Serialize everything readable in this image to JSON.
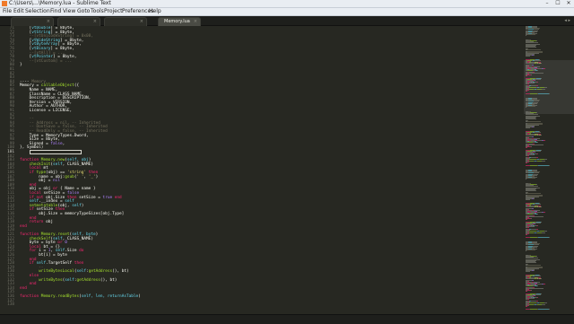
{
  "window": {
    "title": "C:\\Users\\...\\Memory.lua - Sublime Text",
    "controls": [
      "–",
      "☐",
      "✕"
    ]
  },
  "menubar": [
    "File",
    "Edit",
    "Selection",
    "Find",
    "View",
    "Goto",
    "Tools",
    "Project",
    "Preferences",
    "Help"
  ],
  "tabs": [
    {
      "label": "",
      "active": false
    },
    {
      "label": "",
      "active": false
    },
    {
      "label": "",
      "active": false
    },
    {
      "label": "Memory.lua",
      "active": true
    }
  ],
  "editor": {
    "current_line": 101,
    "lines": [
      {
        "n": 71,
        "segs": [
          [
            "    [",
            ""
          ],
          [
            "vtDouble",
            "cn"
          ],
          [
            "] = ",
            ""
          ],
          [
            "8",
            ""
          ],
          [
            "byte",
            ""
          ],
          [
            ",",
            ""
          ]
        ]
      },
      {
        "n": 72,
        "segs": [
          [
            "    [",
            ""
          ],
          [
            "vtString",
            "cn"
          ],
          [
            "] = ",
            ""
          ],
          [
            "8",
            ""
          ],
          [
            "byte",
            ""
          ],
          [
            ",",
            ""
          ]
        ]
      },
      {
        "n": 73,
        "segs": [
          [
            "    ",
            ""
          ],
          [
            "--[vtUnicodeString] = 0x08,",
            "cm"
          ]
        ]
      },
      {
        "n": 74,
        "segs": [
          [
            "    [",
            ""
          ],
          [
            "vtWideString",
            "cn"
          ],
          [
            "] = ",
            ""
          ],
          [
            "8",
            ""
          ],
          [
            "byte",
            ""
          ],
          [
            ",",
            ""
          ]
        ]
      },
      {
        "n": 75,
        "segs": [
          [
            "    [",
            ""
          ],
          [
            "vtByteArray",
            "cn"
          ],
          [
            "] = ",
            ""
          ],
          [
            "8",
            ""
          ],
          [
            "byte",
            ""
          ],
          [
            ",",
            ""
          ]
        ]
      },
      {
        "n": 76,
        "segs": [
          [
            "    [",
            ""
          ],
          [
            "vtBinary",
            "cn"
          ],
          [
            "] = ",
            ""
          ],
          [
            "8",
            ""
          ],
          [
            "byte",
            ""
          ],
          [
            ",",
            ""
          ]
        ]
      },
      {
        "n": 77,
        "segs": [
          [
            "    ",
            ""
          ],
          [
            "--[vtAll] = ...",
            "cm"
          ]
        ]
      },
      {
        "n": 78,
        "segs": [
          [
            "    [",
            ""
          ],
          [
            "vtPointer",
            "cn"
          ],
          [
            "] = ",
            ""
          ],
          [
            "8",
            ""
          ],
          [
            "byte",
            ""
          ],
          [
            ",",
            ""
          ]
        ]
      },
      {
        "n": 79,
        "segs": [
          [
            "    ",
            ""
          ],
          [
            "--[vtCustom] = ...",
            "cm"
          ]
        ]
      },
      {
        "n": 80,
        "segs": [
          [
            "}",
            ""
          ]
        ]
      },
      {
        "n": 81,
        "segs": []
      },
      {
        "n": 82,
        "segs": []
      },
      {
        "n": 83,
        "segs": []
      },
      {
        "n": 84,
        "segs": [
          [
            "---- ",
            ""
          ],
          [
            "Memory",
            "cm"
          ]
        ]
      },
      {
        "n": 85,
        "segs": [
          [
            "Memory = ",
            ""
          ],
          [
            "callableObject",
            "fn"
          ],
          [
            "({",
            ""
          ]
        ]
      },
      {
        "n": 86,
        "segs": [
          [
            "    Name = ",
            ""
          ],
          [
            "NAME",
            ""
          ],
          [
            ",",
            ""
          ]
        ]
      },
      {
        "n": 87,
        "segs": [
          [
            "    ClassName = ",
            ""
          ],
          [
            "CLASS_NAME",
            ""
          ],
          [
            ",",
            ""
          ]
        ]
      },
      {
        "n": 88,
        "segs": [
          [
            "    Description = ",
            ""
          ],
          [
            "DESCRIPTION",
            ""
          ],
          [
            ",",
            ""
          ]
        ]
      },
      {
        "n": 89,
        "segs": [
          [
            "    Version = ",
            ""
          ],
          [
            "VERSION",
            ""
          ],
          [
            ",",
            ""
          ]
        ]
      },
      {
        "n": 90,
        "segs": [
          [
            "    Author = ",
            ""
          ],
          [
            "AUTHOR",
            ""
          ],
          [
            ",",
            ""
          ]
        ]
      },
      {
        "n": 91,
        "segs": [
          [
            "    License = ",
            ""
          ],
          [
            "LICENSE",
            ""
          ],
          [
            ",",
            ""
          ]
        ]
      },
      {
        "n": 92,
        "segs": []
      },
      {
        "n": 93,
        "segs": [
          [
            "    ",
            ""
          ],
          [
            "--",
            "cm"
          ]
        ]
      },
      {
        "n": 94,
        "segs": [
          [
            "    ",
            ""
          ],
          [
            "-- Address = nil, -- Inherited",
            "cm"
          ]
        ]
      },
      {
        "n": 95,
        "segs": [
          [
            "    ",
            ""
          ],
          [
            "-- DontSave = false, -- Inherited",
            "cm"
          ]
        ]
      },
      {
        "n": 96,
        "segs": [
          [
            "    ",
            ""
          ],
          [
            "-- ReadOnly = false, -- Inherited",
            "cm"
          ]
        ]
      },
      {
        "n": 97,
        "segs": [
          [
            "    Type = ",
            ""
          ],
          [
            "MemoryTypes.Dword",
            ""
          ],
          [
            ",",
            ""
          ]
        ]
      },
      {
        "n": 98,
        "segs": [
          [
            "    Size = ",
            ""
          ],
          [
            "8",
            ""
          ],
          [
            "byte",
            ""
          ],
          [
            ",",
            ""
          ]
        ]
      },
      {
        "n": 99,
        "segs": [
          [
            "    Signed = ",
            ""
          ],
          [
            "false",
            "num"
          ],
          [
            ",",
            ""
          ]
        ]
      },
      {
        "n": 100,
        "segs": [
          [
            "}, Symbol)",
            ""
          ]
        ]
      },
      {
        "n": 101,
        "segs": []
      },
      {
        "n": 102,
        "segs": []
      },
      {
        "n": 103,
        "segs": [
          [
            "function ",
            "kw"
          ],
          [
            "Memory.new",
            "fn"
          ],
          [
            "(",
            ""
          ],
          [
            "self, obj",
            "cn"
          ],
          [
            ")",
            ""
          ]
        ]
      },
      {
        "n": 104,
        "segs": [
          [
            "    ",
            ""
          ],
          [
            "checkInit",
            "fn"
          ],
          [
            "(",
            ""
          ],
          [
            "self",
            "cn"
          ],
          [
            ", ",
            ""
          ],
          [
            "CLASS_NAME",
            ""
          ],
          [
            ")",
            ""
          ]
        ]
      },
      {
        "n": 105,
        "segs": [
          [
            "    ",
            ""
          ],
          [
            "local ",
            "kw"
          ],
          [
            "mt",
            ""
          ]
        ]
      },
      {
        "n": 106,
        "segs": [
          [
            "    ",
            ""
          ],
          [
            "if ",
            "kw"
          ],
          [
            "type",
            "fn"
          ],
          [
            "(obj) == ",
            ""
          ],
          [
            "'string'",
            "str"
          ],
          [
            " then",
            "kw"
          ]
        ]
      },
      {
        "n": 107,
        "segs": [
          [
            "        name = obj:",
            ""
          ],
          [
            "gsub",
            "fn"
          ],
          [
            "(",
            ""
          ],
          [
            "' '",
            "str"
          ],
          [
            ", ",
            ""
          ],
          [
            "'_'",
            "str"
          ],
          [
            ")",
            ""
          ]
        ]
      },
      {
        "n": 108,
        "segs": [
          [
            "        obj = ",
            ""
          ],
          [
            "nil",
            "num"
          ]
        ]
      },
      {
        "n": 109,
        "segs": [
          [
            "    ",
            ""
          ],
          [
            "end",
            "kw"
          ]
        ]
      },
      {
        "n": 110,
        "segs": [
          [
            "    obj = obj ",
            ""
          ],
          [
            "or ",
            "kw"
          ],
          [
            "{ Name = name }",
            ""
          ]
        ]
      },
      {
        "n": 111,
        "segs": [
          [
            "    ",
            ""
          ],
          [
            "local ",
            "kw"
          ],
          [
            "setSize = ",
            ""
          ],
          [
            "false",
            "num"
          ]
        ]
      },
      {
        "n": 112,
        "segs": [
          [
            "    ",
            ""
          ],
          [
            "if not ",
            "kw"
          ],
          [
            "obj.Size ",
            ""
          ],
          [
            "then ",
            "kw"
          ],
          [
            "setSize = ",
            ""
          ],
          [
            "true",
            "num"
          ],
          [
            " end",
            "kw"
          ]
        ]
      },
      {
        "n": 113,
        "segs": [
          [
            "    ",
            ""
          ],
          [
            "self",
            "cn"
          ],
          [
            "._",
            ""
          ],
          [
            "_index = ",
            ""
          ],
          [
            "self",
            "cn"
          ]
        ]
      },
      {
        "n": 114,
        "segs": [
          [
            "    ",
            ""
          ],
          [
            "setmetatable",
            "fn"
          ],
          [
            "(obj, ",
            ""
          ],
          [
            "self",
            "cn"
          ],
          [
            ")",
            ""
          ]
        ]
      },
      {
        "n": 115,
        "segs": [
          [
            "    ",
            ""
          ],
          [
            "if ",
            "kw"
          ],
          [
            "setSize ",
            ""
          ],
          [
            "then ",
            "kw"
          ]
        ]
      },
      {
        "n": 116,
        "segs": [
          [
            "        obj.Size = memoryTypeSizes[obj.Type] ",
            ""
          ]
        ]
      },
      {
        "n": 117,
        "segs": [
          [
            "    ",
            ""
          ],
          [
            "end",
            "kw"
          ]
        ]
      },
      {
        "n": 118,
        "segs": [
          [
            "    ",
            ""
          ],
          [
            "return ",
            "kw"
          ],
          [
            "obj",
            ""
          ]
        ]
      },
      {
        "n": 119,
        "segs": [
          [
            "end",
            "kw"
          ]
        ]
      },
      {
        "n": 120,
        "segs": []
      },
      {
        "n": 121,
        "segs": [
          [
            "function ",
            "kw"
          ],
          [
            "Memory.reset",
            "fn"
          ],
          [
            "(",
            ""
          ],
          [
            "self, byte",
            "cn"
          ],
          [
            ")",
            ""
          ]
        ]
      },
      {
        "n": 122,
        "segs": [
          [
            "    ",
            ""
          ],
          [
            "checkSelf",
            "fn"
          ],
          [
            "(",
            ""
          ],
          [
            "self",
            "cn"
          ],
          [
            ", ",
            ""
          ],
          [
            "CLASS_NAME",
            ""
          ],
          [
            ")",
            ""
          ]
        ]
      },
      {
        "n": 123,
        "segs": [
          [
            "    byte = byte ",
            ""
          ],
          [
            "or ",
            "kw"
          ],
          [
            "0",
            "num"
          ]
        ]
      },
      {
        "n": 124,
        "segs": [
          [
            "    ",
            ""
          ],
          [
            "local ",
            "kw"
          ],
          [
            "bt = {}",
            ""
          ]
        ]
      },
      {
        "n": 125,
        "segs": [
          [
            "    ",
            ""
          ],
          [
            "for ",
            "kw"
          ],
          [
            "i = ",
            ""
          ],
          [
            "1",
            "num"
          ],
          [
            ", ",
            ""
          ],
          [
            "self",
            "cn"
          ],
          [
            ".Size ",
            ""
          ],
          [
            "do",
            "kw"
          ]
        ]
      },
      {
        "n": 126,
        "segs": [
          [
            "        bt[i] = byte",
            ""
          ]
        ]
      },
      {
        "n": 127,
        "segs": [
          [
            "    ",
            ""
          ],
          [
            "end",
            "kw"
          ]
        ]
      },
      {
        "n": 128,
        "segs": [
          [
            "    ",
            ""
          ],
          [
            "if ",
            "kw"
          ],
          [
            "self",
            "cn"
          ],
          [
            ".TargetSelf ",
            ""
          ],
          [
            "then",
            "kw"
          ]
        ]
      },
      {
        "n": 129,
        "segs": [
          [
            "        ",
            ""
          ],
          [
            "--",
            "cm"
          ]
        ]
      },
      {
        "n": 130,
        "segs": [
          [
            "        ",
            ""
          ],
          [
            "writeBytesLocal",
            "fn"
          ],
          [
            "(",
            ""
          ],
          [
            "self",
            "cn"
          ],
          [
            ":",
            ""
          ],
          [
            "getAddress",
            "fn"
          ],
          [
            "(), bt)",
            ""
          ]
        ]
      },
      {
        "n": 131,
        "segs": [
          [
            "    ",
            ""
          ],
          [
            "else",
            "kw"
          ]
        ]
      },
      {
        "n": 132,
        "segs": [
          [
            "        ",
            ""
          ],
          [
            "writeBytes",
            "fn"
          ],
          [
            "(",
            ""
          ],
          [
            "self",
            "cn"
          ],
          [
            ":",
            ""
          ],
          [
            "getAddress",
            "fn"
          ],
          [
            "(), bt)",
            ""
          ]
        ]
      },
      {
        "n": 133,
        "segs": [
          [
            "    ",
            ""
          ],
          [
            "end",
            "kw"
          ]
        ]
      },
      {
        "n": 134,
        "segs": [
          [
            "end",
            "kw"
          ]
        ]
      },
      {
        "n": 135,
        "segs": []
      },
      {
        "n": 136,
        "segs": [
          [
            "function ",
            "kw"
          ],
          [
            "Memory.readBytes",
            "fn"
          ],
          [
            "(",
            ""
          ],
          [
            "self, len, returnAsTable",
            "cn"
          ],
          [
            ")",
            ""
          ]
        ]
      },
      {
        "n": 137,
        "segs": []
      },
      {
        "n": 138,
        "segs": []
      }
    ]
  },
  "statusbar": {
    "left": "",
    "right_items": [
      "",
      "",
      ""
    ]
  },
  "colors": {
    "background": "#272822",
    "keyword": "#f92672",
    "function": "#a6e22e",
    "string": "#e6db74",
    "comment": "#75715e",
    "constant": "#66d9ef",
    "number": "#ae81ff"
  }
}
